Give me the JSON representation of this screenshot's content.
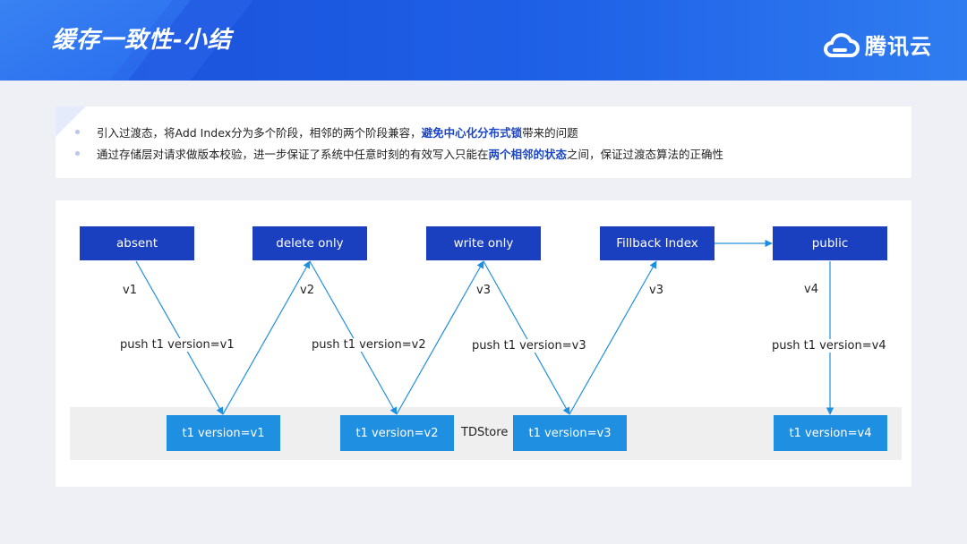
{
  "header": {
    "title": "缓存一致性-小结",
    "logo_text": "腾讯云"
  },
  "notes": {
    "line1": {
      "before": "引入过渡态，将Add Index分为多个阶段，相邻的两个阶段兼容，",
      "highlight": "避免中心化分布式锁",
      "after": "带来的问题"
    },
    "line2": {
      "before": "通过存储层对请求做版本校验，进一步保证了系统中任意时刻的有效写入只能在",
      "highlight": "两个相邻的状态",
      "after": "之间，保证过渡态算法的正确性"
    }
  },
  "diagram": {
    "states": [
      "absent",
      "delete only",
      "write only",
      "Fillback Index",
      "public"
    ],
    "store_label": "TDStore",
    "version_boxes": [
      "t1 version=v1",
      "t1 version=v2",
      "t1 version=v3",
      "t1 version=v4"
    ],
    "version_tags": [
      "v1",
      "v2",
      "v3",
      "v3",
      "v4"
    ],
    "push_labels": [
      "push t1 version=v1",
      "push t1 version=v2",
      "push t1 version=v3",
      "push t1 version=v4"
    ]
  },
  "colors": {
    "header": "#1e5fe6",
    "state_box": "#1a3fbf",
    "version_box": "#1e8fe1",
    "arrow": "#1e8fe1",
    "highlight": "#1c46c8"
  }
}
